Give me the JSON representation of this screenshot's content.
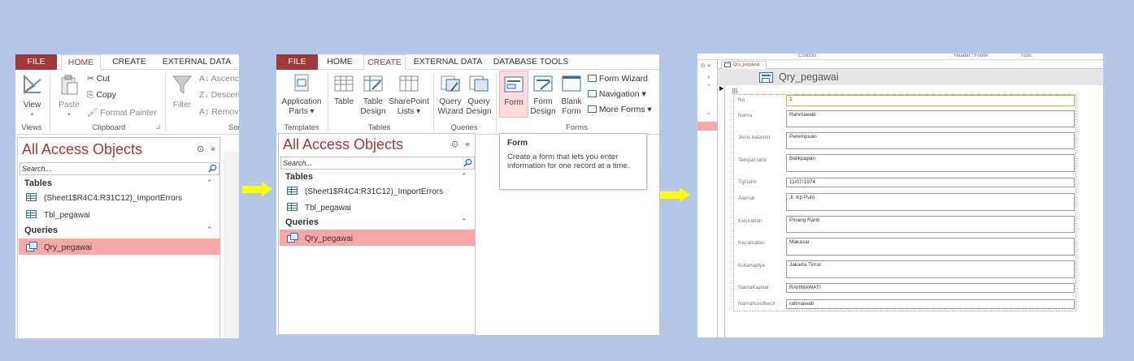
{
  "panel1": {
    "tabs": {
      "file": "FILE",
      "home": "HOME",
      "create": "CREATE",
      "external": "EXTERNAL DATA"
    },
    "views": {
      "view": "View",
      "group": "Views"
    },
    "clipboard": {
      "paste": "Paste",
      "cut": "Cut",
      "copy": "Copy",
      "format_painter": "Format Painter",
      "group": "Clipboard"
    },
    "sort": {
      "filter": "Filter",
      "ascending": "Ascenc",
      "descending": "Descen",
      "remove": "Remov",
      "group": "Sor"
    },
    "nav": {
      "title": "All Access Objects",
      "search_placeholder": "Search...",
      "tables_label": "Tables",
      "tables": [
        "(Sheet1$R4C4:R31C12)_ImportErrors",
        "Tbl_pegawai"
      ],
      "queries_label": "Queries",
      "queries": [
        "Qry_pegawai"
      ]
    }
  },
  "panel2": {
    "tabs": {
      "file": "FILE",
      "home": "HOME",
      "create": "CREATE",
      "external": "EXTERNAL DATA",
      "dbtools": "DATABASE TOOLS"
    },
    "buttons": {
      "app_parts": [
        "Application",
        "Parts ▾"
      ],
      "table": "Table",
      "table_design": [
        "Table",
        "Design"
      ],
      "sharepoint": [
        "SharePoint",
        "Lists ▾"
      ],
      "query_wizard": [
        "Query",
        "Wizard"
      ],
      "query_design": [
        "Query",
        "Design"
      ],
      "form": "Form",
      "form_design": [
        "Form",
        "Design"
      ],
      "blank_form": [
        "Blank",
        "Form"
      ],
      "form_wizard": "Form Wizard",
      "navigation": "Navigation ▾",
      "more_forms": "More Forms ▾"
    },
    "groups": {
      "templates": "Templates",
      "tables": "Tables",
      "queries": "Queries",
      "forms": "Forms"
    },
    "tooltip": {
      "title": "Form",
      "body": "Create a form that lets you enter information for one record at a time."
    },
    "nav": {
      "title": "All Access Objects",
      "search_placeholder": "Search...",
      "tables_label": "Tables",
      "tables": [
        "(Sheet1$R4C4:R31C12)_ImportErrors",
        "Tbl_pegawai"
      ],
      "queries_label": "Queries",
      "queries": [
        "Qry_pegawai"
      ]
    }
  },
  "panel3": {
    "top_labels": {
      "controls": "Controls",
      "header_footer": "Header / Footer",
      "tools": "Tools"
    },
    "tab": "Qry_pegawai",
    "form_title": "Qry_pegawai",
    "fields": [
      {
        "label": "No",
        "value": "1"
      },
      {
        "label": "Nama",
        "value": "Rahmawati"
      },
      {
        "label": "Jenis kelamin",
        "value": "Perempuan"
      },
      {
        "label": "Tempat lahir",
        "value": "Balikpapan"
      },
      {
        "label": "Tgl lahir",
        "value": "11/07/1974"
      },
      {
        "label": "Alamat",
        "value": "Jl. Kp Pulo"
      },
      {
        "label": "Kelurahan",
        "value": "Pinang Ranti"
      },
      {
        "label": "Kecamatan",
        "value": "Makasar"
      },
      {
        "label": "Kotamadya",
        "value": "Jakarta Timur"
      },
      {
        "label": "NamaKapital",
        "value": "RAHMAWATI"
      },
      {
        "label": "Namahurufkecil",
        "value": "rahmawati"
      }
    ]
  },
  "colors": {
    "background": "#b4c7e7",
    "access_red": "#a4373a",
    "selection": "#f8a7a7",
    "arrow": "#ffff00"
  }
}
